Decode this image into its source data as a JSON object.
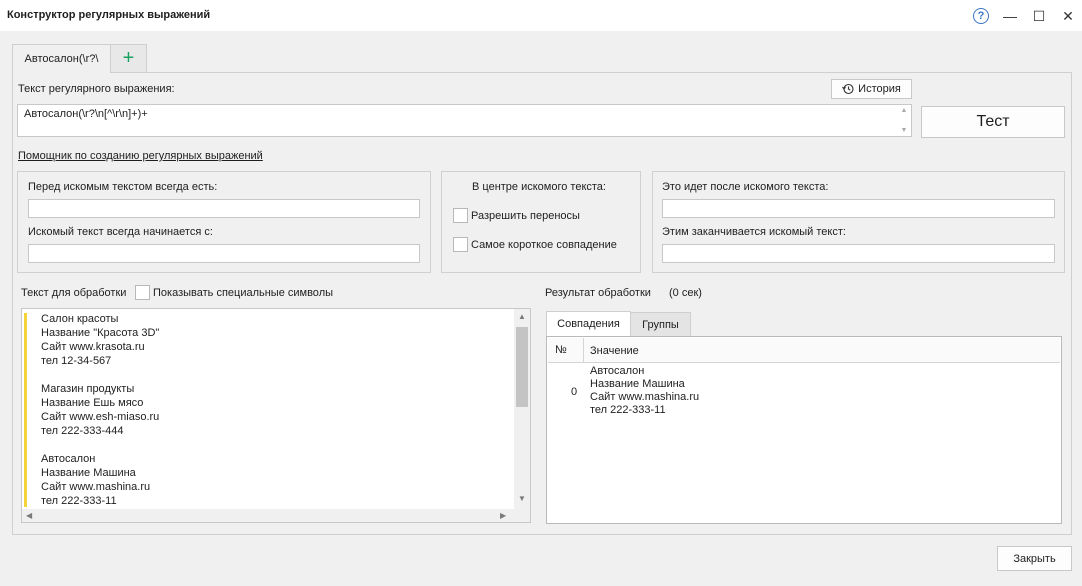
{
  "window": {
    "title": "Конструктор регулярных выражений",
    "help_glyph": "?",
    "minimize_glyph": "—",
    "maximize_glyph": "☐",
    "close_glyph": "✕"
  },
  "tabs": {
    "active_label": "Автосалон(\\r?\\",
    "add_glyph": "+"
  },
  "regex": {
    "label": "Текст регулярного выражения:",
    "history_label": "История",
    "value": "Автосалон(\\r?\\n[^\\r\\n]+)+",
    "test_label": "Тест"
  },
  "helper": {
    "link_text": "Помощник по созданию регулярных выражений",
    "before_label": "Перед искомым текстом всегда есть:",
    "before_value": "",
    "starts_label": "Искомый текст всегда начинается с:",
    "starts_value": "",
    "center_title": "В центре искомого текста:",
    "allow_breaks_label": "Разрешить переносы",
    "shortest_match_label": "Самое короткое совпадение",
    "after_label": "Это идет после искомого текста:",
    "after_value": "",
    "ends_label": "Этим заканчивается искомый текст:",
    "ends_value": ""
  },
  "source": {
    "label": "Текст для обработки",
    "show_special_label": "Показывать специальные символы",
    "text": "Салон красоты\nНазвание \"Красота 3D\"\nСайт www.krasota.ru\nтел 12-34-567\n\nМагазин продукты\nНазвание Ешь мясо\nСайт www.esh-miaso.ru\nтел 222-333-444\n\nАвтосалон\nНазвание Машина\nСайт www.mashina.ru\nтел 222-333-11"
  },
  "result": {
    "label": "Результат обработки",
    "time": "(0 сек)",
    "tabs": [
      "Совпадения",
      "Группы"
    ],
    "columns": [
      "№",
      "Значение"
    ],
    "rows": [
      {
        "num": "0",
        "value": "Автосалон\nНазвание Машина\nСайт www.mashina.ru\nтел 222-333-11"
      }
    ]
  },
  "footer": {
    "close_label": "Закрыть"
  },
  "icons": {
    "history": "history-icon",
    "add": "plus-icon",
    "help": "help-icon"
  },
  "colors": {
    "accent_green": "#1aa260",
    "help_blue": "#3a75c4",
    "highlight_yellow": "#f5d33b"
  }
}
